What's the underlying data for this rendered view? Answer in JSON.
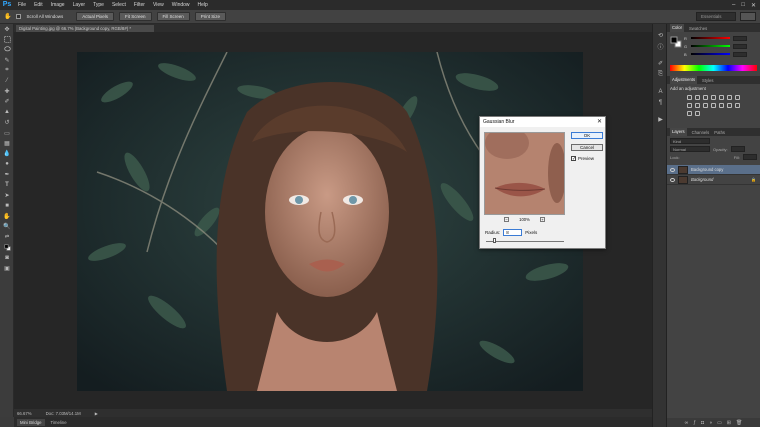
{
  "app": {
    "logo": "Ps",
    "menu": [
      "File",
      "Edit",
      "Image",
      "Layer",
      "Type",
      "Select",
      "Filter",
      "View",
      "Window",
      "Help"
    ],
    "window_controls": [
      "–",
      "□",
      "✕"
    ]
  },
  "options_bar": {
    "scroll_all_windows": "Scroll All Windows",
    "buttons": [
      "Actual Pixels",
      "Fit Screen",
      "Fill Screen",
      "Print Size"
    ],
    "workspace": "Essentials"
  },
  "document": {
    "tab_title": "Digital Painting.jpg @ 66.7% (Background copy, RGB/8#) *",
    "zoom": "66.67%",
    "doc_info": "Doc: 7.03M/14.1M"
  },
  "bottom_tabs": [
    "Mini Bridge",
    "Timeline"
  ],
  "panels": {
    "color_tabs": [
      "Color",
      "Swatches"
    ],
    "rgb_labels": [
      "R",
      "G",
      "B"
    ],
    "adjustments_tabs": [
      "Adjustments",
      "Styles"
    ],
    "adjustments_hint": "Add an adjustment",
    "layers_tabs": [
      "Layers",
      "Channels",
      "Paths"
    ],
    "kind_filter": "Kind",
    "blend_mode": "Normal",
    "opacity_label": "Opacity:",
    "lock_label": "Lock:",
    "fill_label": "Fill:",
    "layers": [
      {
        "name": "Background copy",
        "selected": true
      },
      {
        "name": "Background",
        "selected": false
      }
    ]
  },
  "dialog": {
    "title": "Gaussian Blur",
    "ok": "OK",
    "cancel": "Cancel",
    "preview_label": "Preview",
    "preview_checked": true,
    "zoom": "100%",
    "zoom_out": "−",
    "zoom_in": "+",
    "radius_label": "Radius:",
    "radius_value": "8",
    "radius_unit": "Pixels"
  },
  "colors": {
    "accent": "#31a8ff",
    "selected_layer": "#5a6f8a",
    "panel_bg": "#434343",
    "canvas_bg": "#262626"
  }
}
